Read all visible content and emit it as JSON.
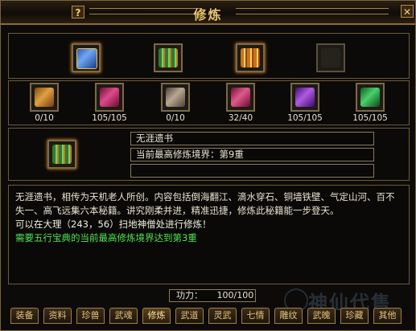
{
  "window": {
    "title": "修炼",
    "help_label": "?",
    "close_label": "✕"
  },
  "top_items": [
    {
      "name": "blue-book-item",
      "color": "#3b6fcf"
    },
    {
      "name": "green-scroll-item",
      "color": "#3f9b3f"
    },
    {
      "name": "gold-scroll-item",
      "color": "#d49a20"
    },
    {
      "name": "empty-slot",
      "color": ""
    }
  ],
  "scrolls": [
    {
      "count": "0/10",
      "color": "#c48a2a"
    },
    {
      "count": "105/105",
      "color": "#c0306a"
    },
    {
      "count": "0/10",
      "color": "#8a7a6a"
    },
    {
      "count": "32/40",
      "color": "#c23e6e"
    },
    {
      "count": "105/105",
      "color": "#8a36c8"
    },
    {
      "count": "105/105",
      "color": "#3ea85a"
    }
  ],
  "selected": {
    "name": "无涯遗书",
    "realm": "当前最高修炼境界：第9重",
    "extra": ""
  },
  "description": {
    "text": "无涯遗书，相传为天机老人所创。内容包括倒海翻江、滴水穿石、铜墙铁壁、气定山河、百不失一、高飞远集六本秘籍。讲究刚柔并进，精准迅捷，修炼此秘籍能一步登天。",
    "location": "可以在大理（243，56）扫地神僧处进行修炼！",
    "requirement": "需要五行宝典的当前最高修炼境界达到第3重"
  },
  "power": {
    "label": "功力：",
    "value": "100/100"
  },
  "tabs": [
    "装备",
    "资料",
    "珍兽",
    "武魂",
    "修炼",
    "武道",
    "灵武",
    "七情",
    "雕纹",
    "武魄",
    "珍藏",
    "其他"
  ],
  "active_tab": "修炼",
  "watermark": "神仙代售"
}
